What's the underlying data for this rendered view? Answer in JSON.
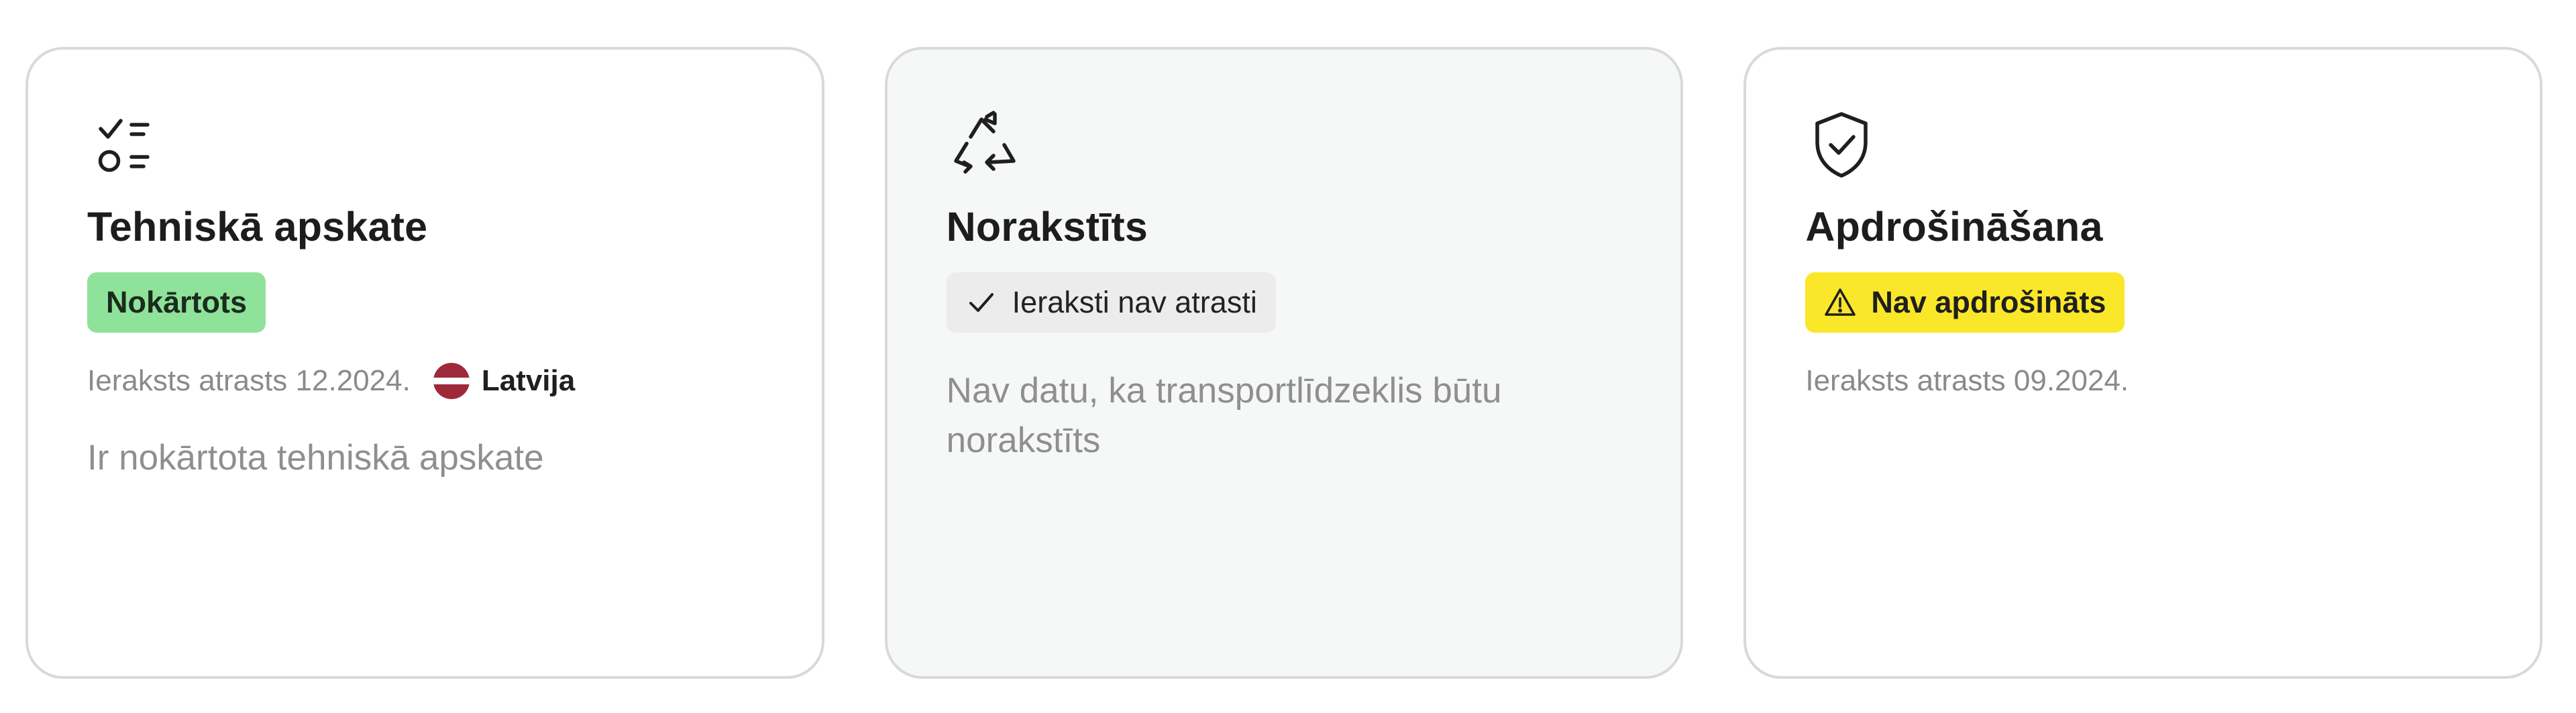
{
  "cards": [
    {
      "icon": "checklist-icon",
      "title": "Tehniskā apskate",
      "badge": {
        "label": "Nokārtots",
        "status": "ok",
        "color": "#8fe29a"
      },
      "meta": {
        "text": "Ieraksts atrasts 12.2024.",
        "flag_icon": "latvia-flag-icon",
        "country": "Latvija"
      },
      "description": "Ir nokārtota tehniskā apskate"
    },
    {
      "icon": "recycle-icon",
      "title": "Norakstīts",
      "badge": {
        "icon": "checkmark-icon",
        "label": "Ieraksti nav atrasti",
        "status": "neutral",
        "color": "#ececec"
      },
      "description": "Nav datu, ka transportlīdzeklis būtu norakstīts"
    },
    {
      "icon": "shield-check-icon",
      "title": "Apdrošināšana",
      "badge": {
        "icon": "warning-icon",
        "label": "Nav apdrošināts",
        "status": "warning",
        "color": "#fbe72a"
      },
      "meta": {
        "text": "Ieraksts atrasts 09.2024."
      }
    }
  ],
  "colors": {
    "card_border": "#d9d9d9",
    "muted_card_background": "#f6f7f7",
    "latvia_flag_red": "#9e2a39"
  }
}
